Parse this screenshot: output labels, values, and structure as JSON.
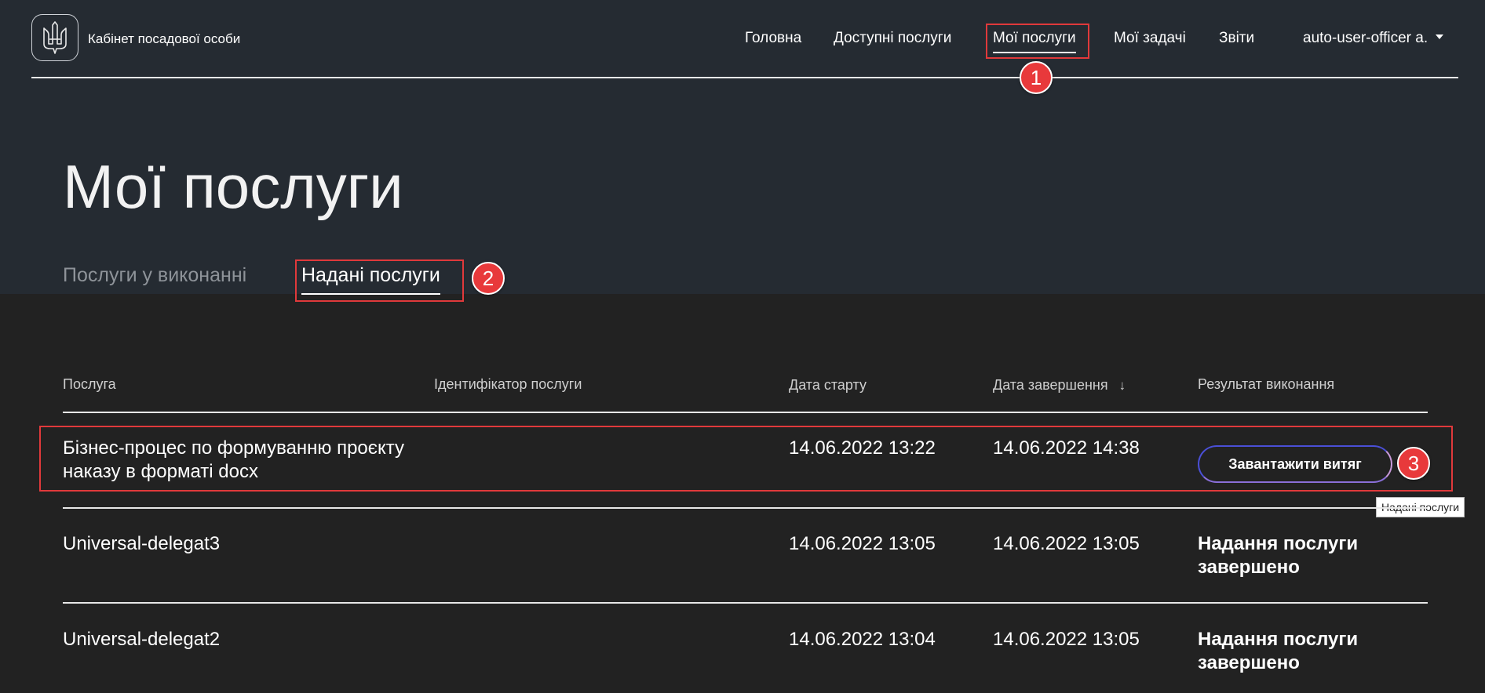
{
  "header": {
    "brand": "Кабінет посадової особи",
    "nav": [
      "Головна",
      "Доступні послуги",
      "Мої послуги",
      "Мої задачі",
      "Звіти"
    ],
    "user": "auto-user-officer a."
  },
  "page": {
    "title": "Мої послуги",
    "tabs": [
      "Послуги у виконанні",
      "Надані послуги"
    ]
  },
  "table": {
    "columns": [
      "Послуга",
      "Ідентифікатор послуги",
      "Дата старту",
      "Дата завершення",
      "Результат виконання"
    ],
    "rows": [
      {
        "service": "Бізнес-процес по формуванню проєкту наказу в форматі docx",
        "id": "",
        "start": "14.06.2022 13:22",
        "end": "14.06.2022 14:38",
        "result": "Завантажити витяг"
      },
      {
        "service": "Universal-delegat3",
        "id": "",
        "start": "14.06.2022 13:05",
        "end": "14.06.2022 13:05",
        "result": "Надання послуги завершено"
      },
      {
        "service": "Universal-delegat2",
        "id": "",
        "start": "14.06.2022 13:04",
        "end": "14.06.2022 13:05",
        "result": "Надання послуги завершено"
      }
    ]
  },
  "tooltip": "Надані послуги",
  "annotations": [
    "1",
    "2",
    "3"
  ],
  "colors": {
    "highlight": "#e0393b",
    "header_bg": "#252b32",
    "body_bg": "#222222"
  },
  "icons": [
    "trident-icon",
    "caret-down-icon",
    "sort-down-icon"
  ]
}
